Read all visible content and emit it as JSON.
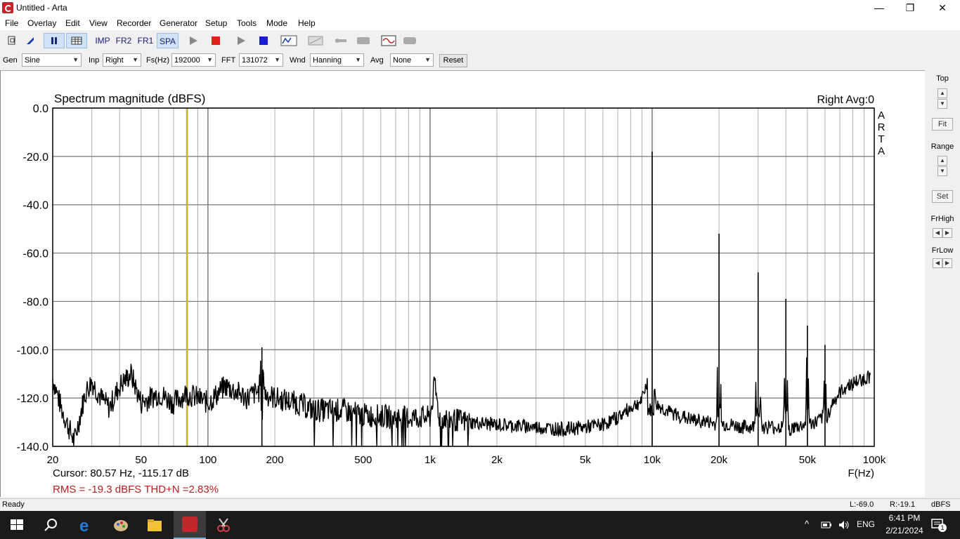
{
  "window": {
    "title": "Untitled - Arta"
  },
  "window_controls": {
    "minimize": "—",
    "maximize": "❐",
    "close": "✕"
  },
  "menu": [
    "File",
    "Overlay",
    "Edit",
    "View",
    "Recorder",
    "Generator",
    "Setup",
    "Tools",
    "Mode",
    "Help"
  ],
  "toolbar": {
    "imp": "IMP",
    "fr2": "FR2",
    "fr1": "FR1",
    "spa": "SPA"
  },
  "settings": {
    "gen_label": "Gen",
    "gen_value": "Sine",
    "inp_label": "Inp",
    "inp_value": "Right",
    "fs_label": "Fs(Hz)",
    "fs_value": "192000",
    "fft_label": "FFT",
    "fft_value": "131072",
    "wnd_label": "Wnd",
    "wnd_value": "Hanning",
    "avg_label": "Avg",
    "avg_value": "None",
    "reset_label": "Reset"
  },
  "plot": {
    "title": "Spectrum magnitude (dBFS)",
    "channel_info": "Right  Avg:0",
    "brand": [
      "A",
      "R",
      "T",
      "A"
    ],
    "cursor_text": "Cursor: 80.57 Hz, -115.17 dB",
    "rms_text": "RMS =  -19.3 dBFS   THD+N =2.83%",
    "xunit": "F(Hz)",
    "colors": {
      "trace": "#000000",
      "cursor": "#c8b430",
      "grid": "#888888",
      "rms": "#b52020"
    }
  },
  "chart_data": {
    "type": "line",
    "title": "Spectrum magnitude (dBFS)",
    "xlabel": "F(Hz)",
    "ylabel": "",
    "x_scale": "log",
    "xlim": [
      20,
      100000
    ],
    "ylim": [
      -140,
      0
    ],
    "grid": true,
    "x_ticks": [
      "20",
      "50",
      "100",
      "200",
      "500",
      "1k",
      "2k",
      "5k",
      "10k",
      "20k",
      "50k",
      "100k"
    ],
    "y_ticks": [
      "0.0",
      "-20.0",
      "-40.0",
      "-60.0",
      "-80.0",
      "-100.0",
      "-120.0",
      "-140.0"
    ],
    "cursor": {
      "x": 80.57,
      "y": -115.17
    },
    "series": [
      {
        "x": [
          20,
          22,
          25,
          28,
          30,
          33,
          36,
          40,
          45,
          50,
          55,
          60,
          70,
          80,
          90,
          100,
          120,
          150,
          170,
          175,
          180,
          200,
          250,
          300,
          400,
          500,
          700,
          1000,
          1050,
          1100,
          1500,
          2000,
          3000,
          4000,
          5000,
          6000,
          7000,
          8000,
          9000,
          9500,
          10000,
          10200,
          10500,
          11000,
          12000,
          14000,
          15000,
          18000,
          19500,
          20000,
          20500,
          22000,
          25000,
          29000,
          30000,
          31000,
          35000,
          39000,
          40000,
          41000,
          45000,
          49000,
          50000,
          51000,
          55000,
          59000,
          60000,
          61000,
          65000,
          70000,
          75000,
          80000,
          90000,
          96000
        ],
        "y": [
          -112,
          -125,
          -138,
          -118,
          -113,
          -120,
          -124,
          -115,
          -110,
          -122,
          -120,
          -118,
          -122,
          -118,
          -120,
          -122,
          -115,
          -120,
          -117,
          -99,
          -118,
          -120,
          -122,
          -125,
          -125,
          -127,
          -128,
          -128,
          -114,
          -128,
          -130,
          -131,
          -132,
          -133,
          -132,
          -131,
          -128,
          -124,
          -121,
          -113,
          -18,
          -117,
          -123,
          -124,
          -126,
          -128,
          -129,
          -130,
          -131,
          -52,
          -131,
          -131,
          -132,
          -132,
          -68,
          -132,
          -132,
          -132,
          -79,
          -133,
          -132,
          -131,
          -90,
          -131,
          -130,
          -128,
          -98,
          -128,
          -122,
          -118,
          -115,
          -114,
          -112,
          -111
        ]
      }
    ]
  },
  "sidepanel": {
    "top_label": "Top",
    "fit_label": "Fit",
    "range_label": "Range",
    "set_label": "Set",
    "frhigh_label": "FrHigh",
    "frlow_label": "FrLow"
  },
  "status": {
    "left": "Ready",
    "l_value": "L:-69.0",
    "r_value": "R:-19.1",
    "unit": "dBFS"
  },
  "taskbar": {
    "lang": "ENG",
    "time": "6:41 PM",
    "date": "2/21/2024",
    "notif_count": "1"
  }
}
